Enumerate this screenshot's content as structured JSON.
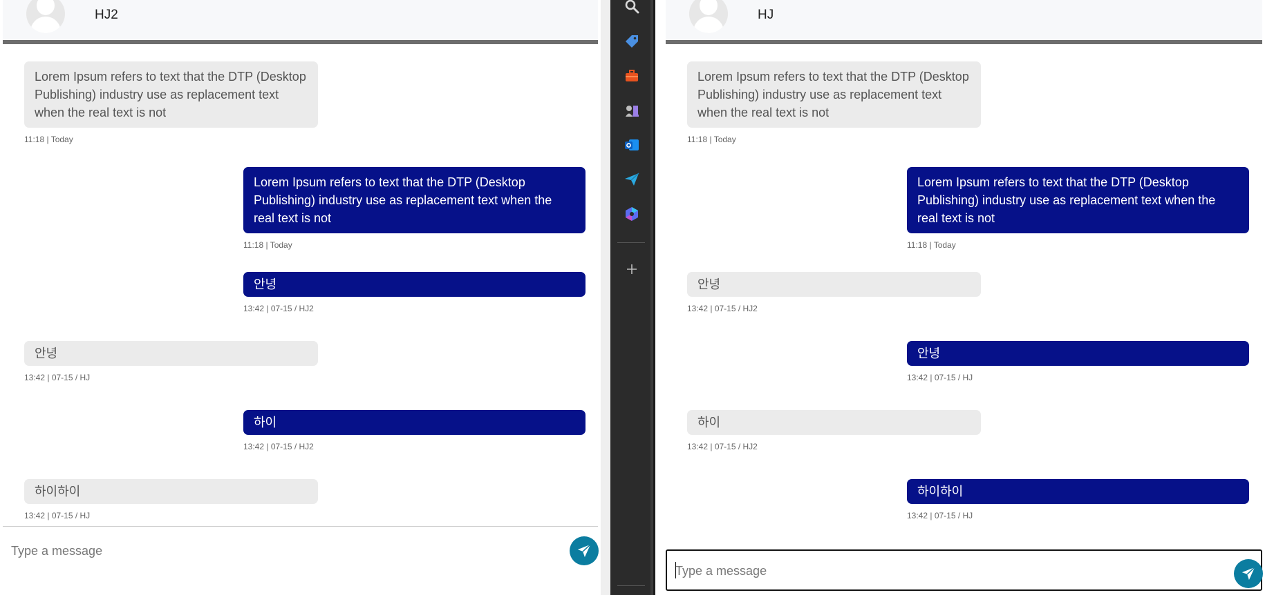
{
  "left_chat": {
    "contact_name": "HJ2",
    "messages": [
      {
        "direction": "in",
        "text": "Lorem Ipsum refers to text that the DTP (Desktop Publishing) industry use as replacement text when the real text is not",
        "meta": "11:18 | Today"
      },
      {
        "direction": "out",
        "text": "Lorem Ipsum refers to text that the DTP (Desktop Publishing) industry use as replacement text when the real text is not",
        "meta": "11:18 | Today"
      },
      {
        "direction": "out",
        "text": "안녕",
        "meta": "13:42 | 07-15 / HJ2"
      },
      {
        "direction": "in",
        "text": "안녕",
        "meta": "13:42 | 07-15 / HJ"
      },
      {
        "direction": "out",
        "text": "하이",
        "meta": "13:42 | 07-15 / HJ2"
      },
      {
        "direction": "in",
        "text": "하이하이",
        "meta": "13:42 | 07-15 / HJ"
      }
    ],
    "input_placeholder": "Type a message"
  },
  "right_chat": {
    "contact_name": "HJ",
    "messages": [
      {
        "direction": "in",
        "text": "Lorem Ipsum refers to text that the DTP (Desktop Publishing) industry use as replacement text when the real text is not",
        "meta": "11:18 | Today"
      },
      {
        "direction": "out",
        "text": "Lorem Ipsum refers to text that the DTP (Desktop Publishing) industry use as replacement text when the real text is not",
        "meta": "11:18 | Today"
      },
      {
        "direction": "in",
        "text": "안녕",
        "meta": "13:42 | 07-15 / HJ2"
      },
      {
        "direction": "out",
        "text": "안녕",
        "meta": "13:42 | 07-15 / HJ"
      },
      {
        "direction": "in",
        "text": "하이",
        "meta": "13:42 | 07-15 / HJ2"
      },
      {
        "direction": "out",
        "text": "하이하이",
        "meta": "13:42 | 07-15 / HJ"
      }
    ],
    "input_placeholder": "Type a message"
  },
  "sidebar": {
    "icons": [
      "search-icon",
      "tag-icon",
      "toolbox-icon",
      "chess-icon",
      "outlook-icon",
      "send-icon",
      "copilot-icon",
      "add-icon"
    ]
  },
  "colors": {
    "outgoing_bubble": "#061189",
    "incoming_bubble": "#ebebeb",
    "send_button": "#0b7da0",
    "sidebar": "#2b2b2b"
  }
}
